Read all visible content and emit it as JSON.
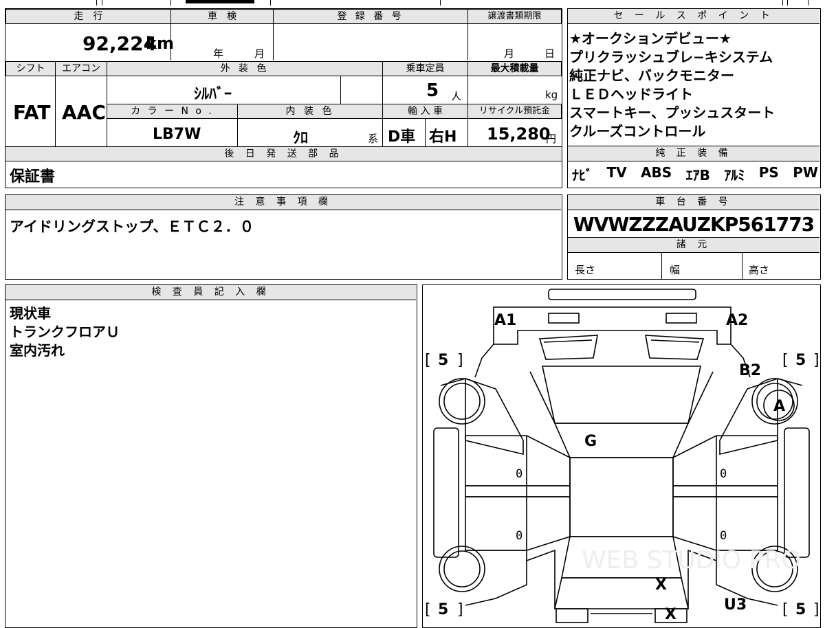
{
  "top_section": {
    "mileage_label": "走　行",
    "mileage_value": "92,224",
    "mileage_unit": "km",
    "shaken_label": "車　検",
    "shaken_year": "年",
    "shaken_month": "月",
    "reg_label": "登 録 番 号",
    "transfer_label": "譲渡書類期限",
    "transfer_month": "月",
    "transfer_day": "日",
    "shift_label": "シフト",
    "shift_value": "FAT",
    "aircon_label": "エアコン",
    "aircon_value": "AAC",
    "exterior_label": "外 装 色",
    "exterior_value": "ｼﾙﾊﾞｰ",
    "capacity_label": "乗車定員",
    "capacity_value": "5",
    "capacity_unit": "人",
    "maxload_label": "最大積載量",
    "maxload_unit": "kg",
    "colorno_label": "カ ラ ー N o .",
    "colorno_value": "LB7W",
    "interior_label": "内 装 色",
    "interior_value": "ｸﾛ",
    "interior_suffix": "系",
    "import_label": "輸 入 車",
    "import_value1": "D車",
    "import_value2": "右H",
    "recycle_label": "リサイクル預託金",
    "recycle_value": "15,280",
    "recycle_unit": "円",
    "later_parts_label": "後 日 発 送 部 品",
    "later_parts_value": "保証書"
  },
  "sales_points": {
    "label": "セ ー ル ス ポ イ ン ト",
    "lines": [
      "★オークションデビュー★",
      "プリクラッシュブレ−キシステム",
      "純正ナビ、バックモニター",
      "ＬＥＤヘッドライト",
      "スマートキー、プッシュスタート",
      "クルーズコントロール"
    ]
  },
  "equipment": {
    "label": "純 正 装 備",
    "items": [
      "ﾅﾋﾞ",
      "TV",
      "ABS",
      "ｴｱB",
      "ｱﾙﾐ",
      "PS",
      "PW"
    ]
  },
  "notes": {
    "label": "注 意 事 項 欄",
    "text": "アイドリングストップ、ＥＴＣ２．０"
  },
  "chassis": {
    "label": "車 台 番 号",
    "value": "WVWZZZAUZKP561773",
    "specs_label": "諸 元",
    "length_label": "長さ",
    "width_label": "幅",
    "height_label": "高さ"
  },
  "inspector": {
    "label": "検 査 員 記 入 欄",
    "lines": [
      "現状車",
      "トランクフロアＵ",
      "室内汚れ"
    ]
  },
  "diagram": {
    "marks": {
      "a1": "A1",
      "a2": "A2",
      "b2": "B2",
      "a": "A",
      "g": "G",
      "x1": "X",
      "x2": "X",
      "u3": "U3"
    },
    "tire_fl": "5",
    "tire_fr": "5",
    "tire_rl": "5",
    "tire_rr": "5",
    "bracket_open": "[",
    "bracket_close": "]",
    "door_zero": "0",
    "watermark": "WEB STUDIO PRO"
  }
}
